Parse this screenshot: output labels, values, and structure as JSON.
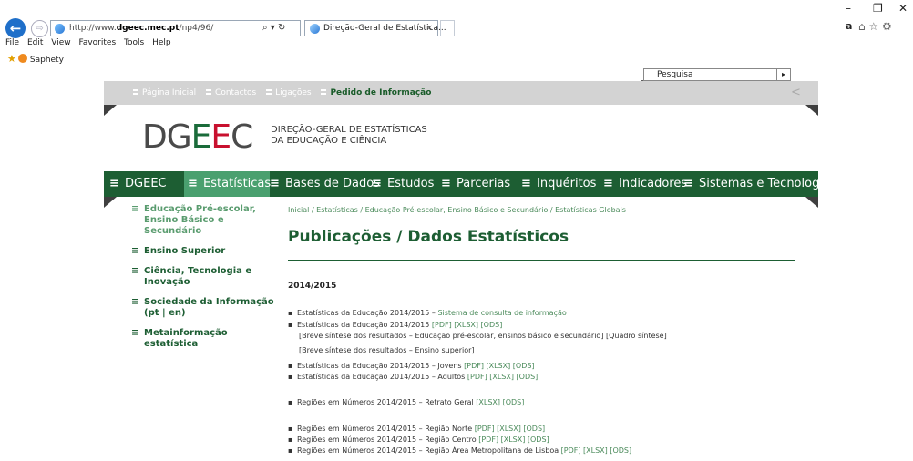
{
  "browser": {
    "url_prefix": "http://www.",
    "url_domain": "dgeec.mec.pt",
    "url_path": "/np4/96/",
    "address_icons": "⌕ ▾ ↻",
    "tab_title": "Direção-Geral de Estatística...",
    "tab_close": "×",
    "back": "←",
    "forward": "⇨",
    "win_minimize": "–",
    "win_restore": "❐",
    "win_close": "✕",
    "toolbar_icons": "⌂ ☆ ⚙",
    "menu": [
      "File",
      "Edit",
      "View",
      "Favorites",
      "Tools",
      "Help"
    ],
    "favorites": [
      "Saphety"
    ]
  },
  "site": {
    "search_label": "Pesquisa",
    "search_go": "▸",
    "share": "<",
    "top_links": [
      "Página Inicial",
      "Contactos",
      "Ligações",
      "Pedido de Informação"
    ],
    "logo_text": {
      "a": "DG",
      "e1": "E",
      "e2": "E",
      "c": "C"
    },
    "org_line1": "DIREÇÃO-GERAL DE ESTATÍSTICAS",
    "org_line2": "DA EDUCAÇÃO E CIÊNCIA",
    "main_nav": [
      "DGEEC",
      "Estatísticas",
      "Bases de Dados",
      "Estudos",
      "Parcerias",
      "Inquéritos",
      "Indicadores",
      "Sistemas e Tecnologias"
    ],
    "menu_mark": "≡",
    "sidebar": [
      "Educação Pré-escolar, Ensino Básico e Secundário",
      "Ensino Superior",
      "Ciência, Tecnologia e Inovação",
      "Sociedade da Informação (pt | en)",
      "Metainformação estatística"
    ],
    "breadcrumb": "Inicial / Estatísticas / Educação Pré-escolar, Ensino Básico e Secundário / Estatísticas Globais",
    "page_title": "Publicações / Dados Estatísticos",
    "year": "2014/2015",
    "bullet": "▪",
    "pubs": {
      "p1_text": "Estatísticas da Educação 2014/2015 – ",
      "p1_link": "Sistema de consulta de informação",
      "p2_text": "Estatísticas da Educação 2014/2015 ",
      "p2_links": "[PDF] [XLSX] [ODS]",
      "p2_sub1": "[Breve síntese dos resultados – Educação pré-escolar, ensinos básico e secundário] [Quadro síntese]",
      "p2_sub2": "[Breve síntese dos resultados – Ensino superior]",
      "p3_text": "Estatísticas da Educação 2014/2015 – Jovens ",
      "p3_links": "[PDF] [XLSX] [ODS]",
      "p4_text": "Estatísticas da Educação 2014/2015 – Adultos ",
      "p4_links": "[PDF] [XLSX] [ODS]",
      "p5_text": "Regiões em Números 2014/2015 – Retrato Geral ",
      "p5_links": "[XLSX] [ODS]",
      "p6_text": "Regiões em Números 2014/2015 – Região Norte ",
      "p6_links": "[PDF] [XLSX] [ODS]",
      "p7_text": "Regiões em Números 2014/2015 – Região Centro ",
      "p7_links": "[PDF] [XLSX] [ODS]",
      "p8_text": "Regiões em Números 2014/2015 – Região Área Metropolitana de Lisboa ",
      "p8_links": "[PDF] [XLSX] [ODS]"
    }
  },
  "colors": {
    "dark_green": "#1d5e33",
    "active_green": "#4aa06f",
    "link_green": "#4a8a5a",
    "strip_gray": "#d3d3d3"
  }
}
